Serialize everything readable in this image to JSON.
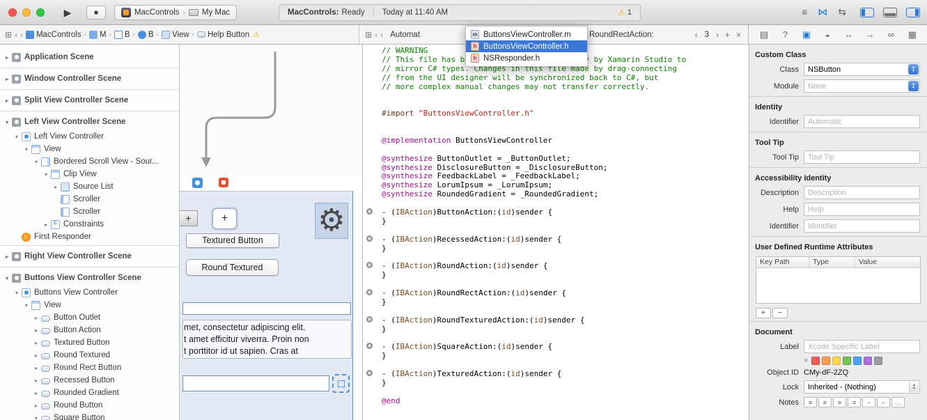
{
  "toolbar": {
    "scheme": "MacControls",
    "destination": "My Mac",
    "run_glyph": "▶",
    "stop_glyph": "■",
    "status": {
      "app": "MacControls:",
      "state": "Ready",
      "time": "Today at 11:40 AM",
      "warnings": "1",
      "warning_glyph": "⚠"
    },
    "editor_mode_icons": [
      {
        "name": "standard-editor",
        "glyph": "≡",
        "active": false
      },
      {
        "name": "assistant-editor",
        "glyph": "⋈",
        "active": true
      },
      {
        "name": "version-editor",
        "glyph": "⇆",
        "active": false
      }
    ],
    "panel_toggles": [
      {
        "name": "navigator-panel",
        "side": "left",
        "active": true
      },
      {
        "name": "debug-area-panel",
        "side": "bottom",
        "active": false
      },
      {
        "name": "utilities-panel",
        "side": "right",
        "active": true
      }
    ]
  },
  "jumpbar_ib": {
    "related_glyph": "⊞",
    "back_glyph": "‹",
    "forward_glyph": "›",
    "segments": [
      {
        "label": "MacControls",
        "icon": "project"
      },
      {
        "label": "M",
        "icon": "folder"
      },
      {
        "label": "B",
        "icon": "storyboard"
      },
      {
        "label": "B",
        "icon": "scenedoc"
      },
      {
        "label": "View",
        "icon": "viewseg"
      },
      {
        "label": "Help Button",
        "icon": "buttonseg",
        "warning": true
      }
    ]
  },
  "jumpbar_assistant": {
    "related_glyph": "⊞",
    "back_glyph": "‹",
    "forward_glyph": "›",
    "mode_segment": "Automat",
    "symbol_segment": "RoundRectAction:",
    "prev": "‹",
    "counter": "3",
    "next": "›",
    "add": "+",
    "close": "×"
  },
  "dropdown": {
    "items": [
      {
        "label": "ButtonsViewController.m",
        "ext": "m",
        "selected": false
      },
      {
        "label": "ButtonsViewController.h",
        "ext": "h",
        "selected": true
      },
      {
        "label": "NSResponder.h",
        "ext": "h",
        "selected": false
      }
    ]
  },
  "sidebar": {
    "items": [
      {
        "label": "Application Scene",
        "depth": 0,
        "disc": "right",
        "icon": "scene",
        "top": true
      },
      {
        "label": "Window Controller Scene",
        "depth": 0,
        "disc": "right",
        "icon": "scene",
        "top": true,
        "sep": true
      },
      {
        "label": "Split View Controller Scene",
        "depth": 0,
        "disc": "right",
        "icon": "scene",
        "top": true,
        "sep": true
      },
      {
        "label": "Left View Controller Scene",
        "depth": 0,
        "disc": "down",
        "icon": "scene",
        "top": true,
        "sep": true
      },
      {
        "label": "Left View Controller",
        "depth": 1,
        "disc": "down",
        "icon": "vc"
      },
      {
        "label": "View",
        "depth": 2,
        "disc": "down",
        "icon": "view"
      },
      {
        "label": "Bordered Scroll View - Sour...",
        "depth": 3,
        "disc": "down",
        "icon": "scroll"
      },
      {
        "label": "Clip View",
        "depth": 4,
        "disc": "down",
        "icon": "clip"
      },
      {
        "label": "Source List",
        "depth": 5,
        "disc": "right",
        "icon": "sourcelist"
      },
      {
        "label": "Scroller",
        "depth": 5,
        "disc": "none",
        "icon": "scroller"
      },
      {
        "label": "Scroller",
        "depth": 5,
        "disc": "none",
        "icon": "scroller"
      },
      {
        "label": "Constraints",
        "depth": 4,
        "disc": "right",
        "icon": "constraints"
      },
      {
        "label": "First Responder",
        "depth": 1,
        "disc": "none",
        "icon": "responder"
      },
      {
        "label": "Right View Controller Scene",
        "depth": 0,
        "disc": "right",
        "icon": "scene",
        "top": true,
        "sep": true
      },
      {
        "label": "Buttons View Controller Scene",
        "depth": 0,
        "disc": "down",
        "icon": "scene",
        "top": true,
        "sep": true
      },
      {
        "label": "Buttons View Controller",
        "depth": 1,
        "disc": "down",
        "icon": "vc"
      },
      {
        "label": "View",
        "depth": 2,
        "disc": "down",
        "icon": "view"
      },
      {
        "label": "Button Outlet",
        "depth": 3,
        "disc": "right",
        "icon": "button"
      },
      {
        "label": "Button Action",
        "depth": 3,
        "disc": "right",
        "icon": "button"
      },
      {
        "label": "Textured Button",
        "depth": 3,
        "disc": "right",
        "icon": "button"
      },
      {
        "label": "Round Textured",
        "depth": 3,
        "disc": "right",
        "icon": "button"
      },
      {
        "label": "Round Rect Button",
        "depth": 3,
        "disc": "right",
        "icon": "button"
      },
      {
        "label": "Recessed Button",
        "depth": 3,
        "disc": "right",
        "icon": "button"
      },
      {
        "label": "Rounded Gradient",
        "depth": 3,
        "disc": "right",
        "icon": "button"
      },
      {
        "label": "Round Button",
        "depth": 3,
        "disc": "right",
        "icon": "button"
      },
      {
        "label": "Square Button",
        "depth": 3,
        "disc": "down",
        "icon": "button"
      }
    ]
  },
  "canvas": {
    "gradient_plus_label": "+",
    "round_plus_label": "+",
    "gear_glyph": "⚙",
    "textured_button_label": "Textured Button",
    "round_textured_label": "Round Textured",
    "lorem_lines": [
      "met, consectetur adipiscing elit.",
      "t amet efficitur viverra. Proin non",
      "t porttitor id ut sapien. Cras at"
    ]
  },
  "code": {
    "lines": [
      {
        "t": [
          [
            "c",
            "// WARNING"
          ]
        ]
      },
      {
        "t": [
          [
            "c",
            "// This file has been generated automatically by Xamarin Studio to"
          ]
        ]
      },
      {
        "t": [
          [
            "c",
            "// mirror C# types. Changes in this file made by drag-connecting"
          ]
        ]
      },
      {
        "t": [
          [
            "c",
            "// from the UI designer will be synchronized back to C#, but"
          ]
        ]
      },
      {
        "t": [
          [
            "c",
            "// more complex manual changes may not transfer correctly."
          ]
        ]
      },
      {
        "t": []
      },
      {
        "t": []
      },
      {
        "t": [
          [
            "p",
            "#import "
          ],
          [
            "s",
            "\"ButtonsViewController.h\""
          ]
        ]
      },
      {
        "t": []
      },
      {
        "t": []
      },
      {
        "t": [
          [
            "k",
            "@implementation"
          ],
          [
            "n",
            " ButtonsViewController"
          ]
        ]
      },
      {
        "t": []
      },
      {
        "t": [
          [
            "k",
            "@synthesize"
          ],
          [
            "n",
            " ButtonOutlet = _ButtonOutlet;"
          ]
        ]
      },
      {
        "t": [
          [
            "k",
            "@synthesize"
          ],
          [
            "n",
            " DisclosureButton = _DisclosureButton;"
          ]
        ]
      },
      {
        "t": [
          [
            "k",
            "@synthesize"
          ],
          [
            "n",
            " FeedbackLabel = _FeedbackLabel;"
          ]
        ]
      },
      {
        "t": [
          [
            "k",
            "@synthesize"
          ],
          [
            "n",
            " LorumIpsum = _LorumIpsum;"
          ]
        ]
      },
      {
        "t": [
          [
            "k",
            "@synthesize"
          ],
          [
            "n",
            " RoundedGradient = _RoundedGradient;"
          ]
        ]
      },
      {
        "t": []
      },
      {
        "w": true,
        "t": [
          [
            "n",
            "- ("
          ],
          [
            "m",
            "IBAction"
          ],
          [
            "n",
            ")ButtonAction:("
          ],
          [
            "m",
            "id"
          ],
          [
            "n",
            ")sender {"
          ]
        ]
      },
      {
        "t": [
          [
            "n",
            "}"
          ]
        ]
      },
      {
        "t": []
      },
      {
        "w": true,
        "t": [
          [
            "n",
            "- ("
          ],
          [
            "m",
            "IBAction"
          ],
          [
            "n",
            ")RecessedAction:("
          ],
          [
            "m",
            "id"
          ],
          [
            "n",
            ")sender {"
          ]
        ]
      },
      {
        "t": [
          [
            "n",
            "}"
          ]
        ]
      },
      {
        "t": []
      },
      {
        "w": true,
        "t": [
          [
            "n",
            "- ("
          ],
          [
            "m",
            "IBAction"
          ],
          [
            "n",
            ")RoundAction:("
          ],
          [
            "m",
            "id"
          ],
          [
            "n",
            ")sender {"
          ]
        ]
      },
      {
        "t": [
          [
            "n",
            "}"
          ]
        ]
      },
      {
        "t": []
      },
      {
        "w": true,
        "t": [
          [
            "n",
            "- ("
          ],
          [
            "m",
            "IBAction"
          ],
          [
            "n",
            ")RoundRectAction:("
          ],
          [
            "m",
            "id"
          ],
          [
            "n",
            ")sender {"
          ]
        ]
      },
      {
        "t": [
          [
            "n",
            "}"
          ]
        ]
      },
      {
        "t": []
      },
      {
        "w": true,
        "t": [
          [
            "n",
            "- ("
          ],
          [
            "m",
            "IBAction"
          ],
          [
            "n",
            ")RoundTexturedAction:("
          ],
          [
            "m",
            "id"
          ],
          [
            "n",
            ")sender {"
          ]
        ]
      },
      {
        "t": [
          [
            "n",
            "}"
          ]
        ]
      },
      {
        "t": []
      },
      {
        "w": true,
        "t": [
          [
            "n",
            "- ("
          ],
          [
            "m",
            "IBAction"
          ],
          [
            "n",
            ")SquareAction:("
          ],
          [
            "m",
            "id"
          ],
          [
            "n",
            ")sender {"
          ]
        ]
      },
      {
        "t": [
          [
            "n",
            "}"
          ]
        ]
      },
      {
        "t": []
      },
      {
        "w": true,
        "t": [
          [
            "n",
            "- ("
          ],
          [
            "m",
            "IBAction"
          ],
          [
            "n",
            ")TexturedAction:("
          ],
          [
            "m",
            "id"
          ],
          [
            "n",
            ")sender {"
          ]
        ]
      },
      {
        "t": [
          [
            "n",
            "}"
          ]
        ]
      },
      {
        "t": []
      },
      {
        "t": [
          [
            "k",
            "@end"
          ]
        ]
      }
    ]
  },
  "inspector": {
    "tabs": [
      {
        "name": "file-inspector",
        "glyph": "▤",
        "selected": false
      },
      {
        "name": "quick-help-inspector",
        "glyph": "?",
        "selected": false
      },
      {
        "name": "identity-inspector",
        "glyph": "▣",
        "selected": true
      },
      {
        "name": "attributes-inspector",
        "glyph": "◒",
        "selected": false
      },
      {
        "name": "size-inspector",
        "glyph": "↔",
        "selected": false
      },
      {
        "name": "connections-inspector",
        "glyph": "→",
        "selected": false
      },
      {
        "name": "bindings-inspector",
        "glyph": "∞",
        "selected": false
      },
      {
        "name": "view-effects-inspector",
        "glyph": "▦",
        "selected": false
      }
    ],
    "custom_class": {
      "title": "Custom Class",
      "class_label": "Class",
      "class_value": "NSButton",
      "module_label": "Module",
      "module_placeholder": "None"
    },
    "identity": {
      "title": "Identity",
      "identifier_label": "Identifier",
      "identifier_placeholder": "Automatic"
    },
    "tool_tip": {
      "title": "Tool Tip",
      "label": "Tool Tip",
      "placeholder": "Tool Tip"
    },
    "accessibility": {
      "title": "Accessibility Identity",
      "description_label": "Description",
      "description_placeholder": "Description",
      "help_label": "Help",
      "help_placeholder": "Help",
      "identifier_label": "Identifier",
      "identifier_placeholder": "Identifier"
    },
    "runtime_attributes": {
      "title": "User Defined Runtime Attributes",
      "columns": [
        "Key Path",
        "Type",
        "Value"
      ],
      "add_label": "+",
      "remove_label": "−"
    },
    "document": {
      "title": "Document",
      "label_label": "Label",
      "label_placeholder": "Xcode Specific Label",
      "clear_color_glyph": "×",
      "swatches": [
        "#f45e57",
        "#f7a04c",
        "#f8d84a",
        "#74c353",
        "#4aa3f5",
        "#b16ee0",
        "#9c9ca1"
      ],
      "object_id_label": "Object ID",
      "object_id_value": "CMy-dF-2ZQ",
      "lock_label": "Lock",
      "lock_value": "Inherited - (Nothing)",
      "notes_label": "Notes",
      "notes_buttons": [
        "≡",
        "≡",
        "≡",
        "≡",
        "−",
        "−",
        "…"
      ]
    }
  }
}
